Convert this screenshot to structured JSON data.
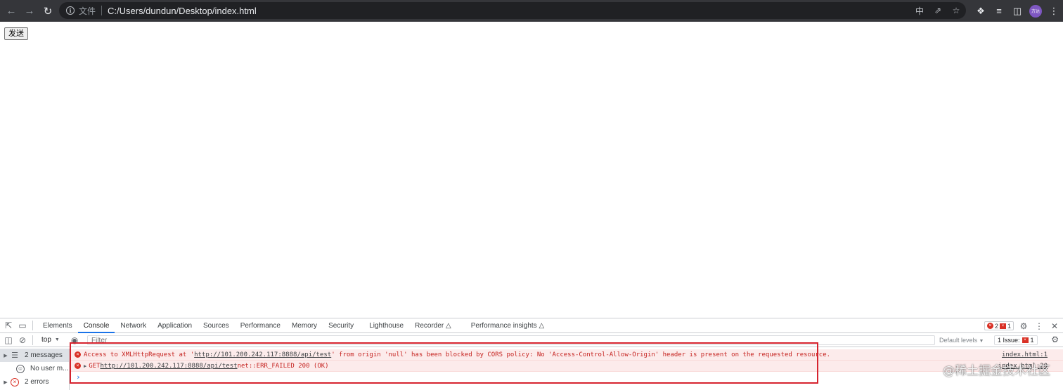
{
  "browser": {
    "back_icon": "back-arrow-icon",
    "forward_icon": "forward-arrow-icon",
    "reload_icon": "reload-icon",
    "scheme_label": "文件",
    "url": "C:/Users/dundun/Desktop/index.html",
    "avatar_text": "方达"
  },
  "page": {
    "send_button_label": "发送"
  },
  "devtools": {
    "tabs": [
      {
        "label": "Elements"
      },
      {
        "label": "Console"
      },
      {
        "label": "Network"
      },
      {
        "label": "Application"
      },
      {
        "label": "Sources"
      },
      {
        "label": "Performance"
      },
      {
        "label": "Memory"
      },
      {
        "label": "Security"
      },
      {
        "label": "Lighthouse"
      },
      {
        "label": "Recorder"
      },
      {
        "label": "Performance insights"
      }
    ],
    "selected_tab": "Console",
    "error_count": "2",
    "issue_count": "1",
    "context": "top",
    "filter_placeholder": "Filter",
    "levels_label": "Default levels",
    "issues_label": "1 Issue:",
    "issues_count": "1",
    "sidebar": [
      {
        "label": "2 messages"
      },
      {
        "label": "No user m..."
      },
      {
        "label": "2 errors"
      }
    ],
    "messages": [
      {
        "prefix": "Access to XMLHttpRequest at '",
        "link": "http://101.200.242.117:8888/api/test",
        "suffix": "' from origin 'null' has been blocked by CORS policy: No 'Access-Control-Allow-Origin' header is present on the requested resource.",
        "source": "index.html:1"
      },
      {
        "prefix": "GET ",
        "link": "http://101.200.242.117:8888/api/test",
        "suffix": " net::ERR_FAILED 200 (OK)",
        "source": "index.html:20"
      }
    ],
    "prompt": "›"
  },
  "colors": {
    "accent": "#1a73e8",
    "error": "#d93025",
    "highlight": "#d6232e",
    "chrome_bg": "#35363a"
  },
  "watermark": "@稀土掘金技术社区"
}
